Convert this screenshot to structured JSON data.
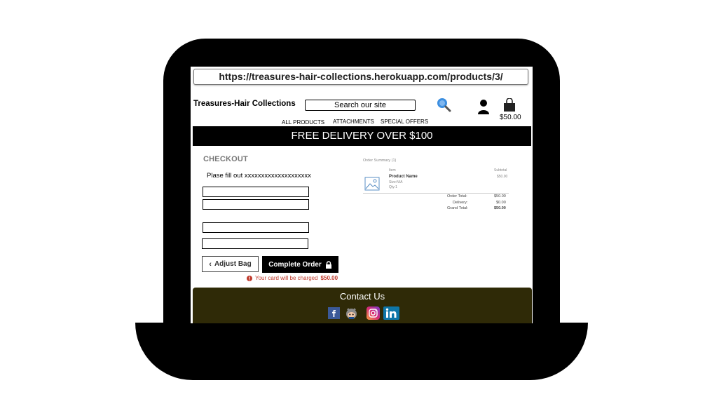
{
  "browser": {
    "url": "https://treasures-hair-collections.herokuapp.com/products/3/"
  },
  "header": {
    "brand": "Treasures-Hair Collections",
    "search_placeholder": "Search our site",
    "bag_total": "$50.00",
    "nav": [
      "ALL PRODUCTS",
      "ATTACHMENTS",
      "SPECIAL OFFERS"
    ]
  },
  "banner": {
    "text": "FREE DELIVERY OVER $100"
  },
  "checkout": {
    "title": "CHECKOUT",
    "instruction": "Plase fill out xxxxxxxxxxxxxxxxxxxx",
    "adjust_label": "Adjust Bag",
    "complete_label": "Complete Order",
    "charge_prefix": "Your card will be charged",
    "charge_amount": "$50.00"
  },
  "summary": {
    "title": "Order Summary (1)",
    "item_header": "Item",
    "subtotal_header": "Subtotal",
    "product_name": "Product Name",
    "product_size": "Size:N/A",
    "product_qty": "Qty:1",
    "product_subtotal": "$50.00",
    "order_total_label": "Order Total:",
    "order_total": "$50.00",
    "delivery_label": "Delivery:",
    "delivery": "$0.00",
    "grand_total_label": "Grand Total:",
    "grand_total": "$50.00"
  },
  "footer": {
    "title": "Contact Us"
  },
  "icons": {
    "search": "search-icon",
    "user": "user-icon",
    "bag": "shopping-bag-icon",
    "image": "image-placeholder-icon",
    "facebook": "facebook-icon",
    "github": "github-icon",
    "instagram": "instagram-icon",
    "linkedin": "linkedin-icon"
  },
  "colors": {
    "banner_bg": "#000000",
    "footer_bg": "#2f2a07",
    "alert_red": "#c0392b",
    "search_blue": "#3d8fe0"
  }
}
